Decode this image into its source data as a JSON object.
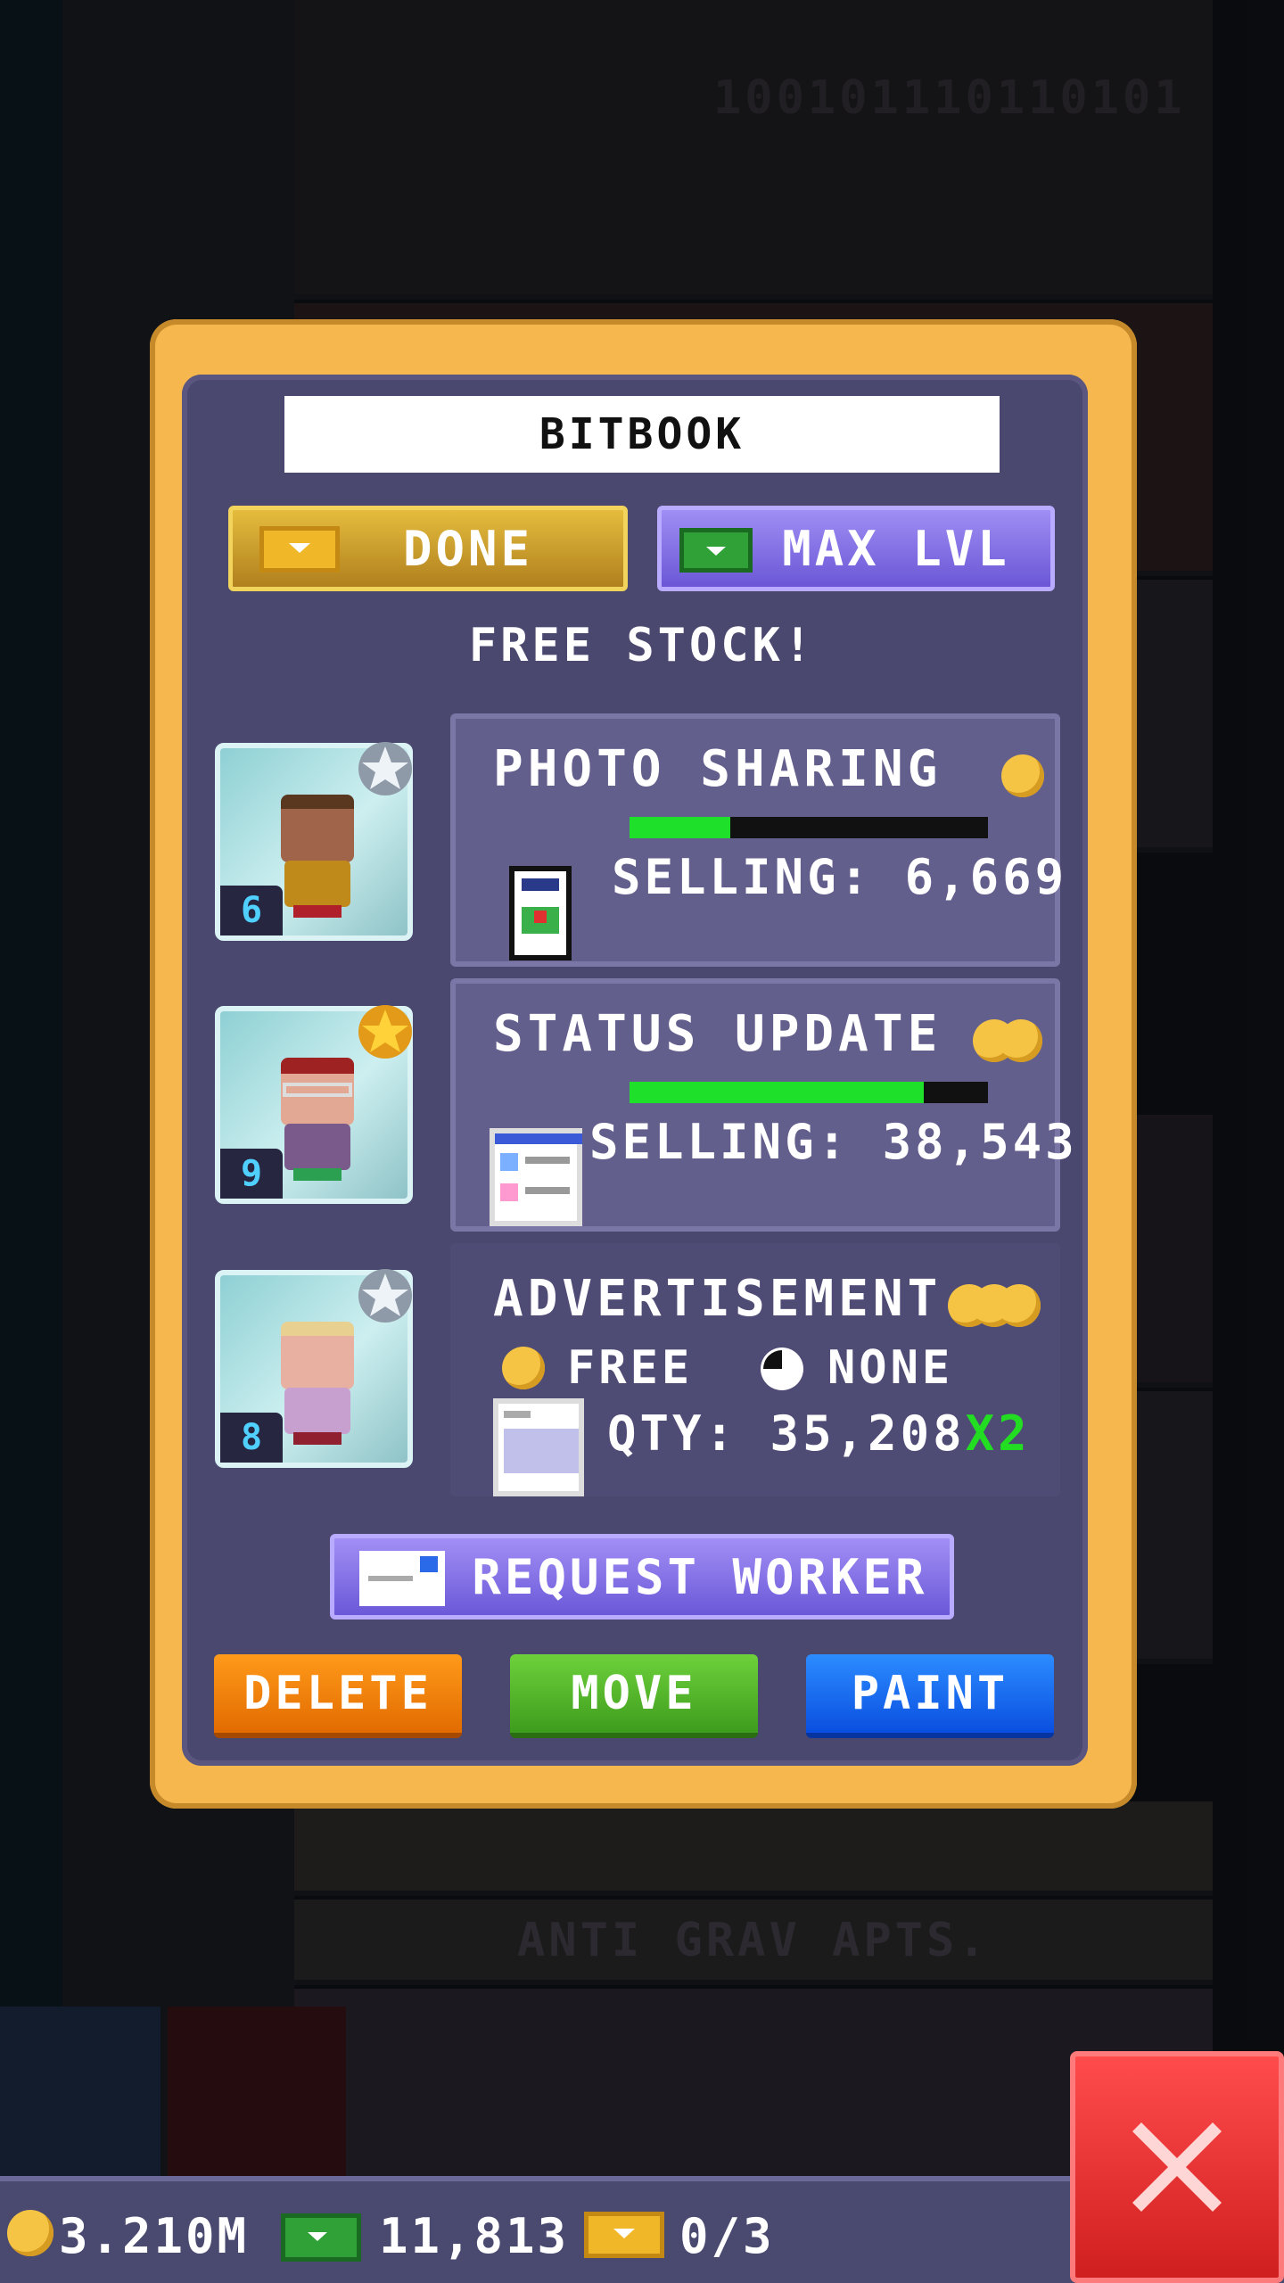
{
  "dialog": {
    "title": "BITBOOK",
    "done_label": "DONE",
    "max_label": "MAX LVL",
    "free_stock": "FREE STOCK!"
  },
  "products": [
    {
      "name": "PHOTO SHARING",
      "selling": "SELLING: 6,669",
      "progress": 0.28,
      "coins": 1,
      "worker_level": "6",
      "star": "silver"
    },
    {
      "name": "STATUS UPDATE",
      "selling": "SELLING: 38,543",
      "progress": 0.82,
      "coins": 2,
      "worker_level": "9",
      "star": "gold"
    },
    {
      "name": "ADVERTISEMENT",
      "free_label": "FREE",
      "none_label": "NONE",
      "qty": "QTY: 35,208",
      "multiplier": "X2",
      "coins": 3,
      "worker_level": "8",
      "star": "silver"
    }
  ],
  "actions": {
    "request_worker": "REQUEST WORKER",
    "delete": "DELETE",
    "move": "MOVE",
    "paint": "PAINT"
  },
  "background": {
    "binary": "100101110110101",
    "floor_label": "ANTI GRAV APTS."
  },
  "status_bar": {
    "coins": "3.210M",
    "bux": "11,813",
    "tickets": "0/3"
  },
  "colors": {
    "dialog_frame": "#f6b74f",
    "panel": "#4b4870",
    "progress": "#1ee02a"
  }
}
